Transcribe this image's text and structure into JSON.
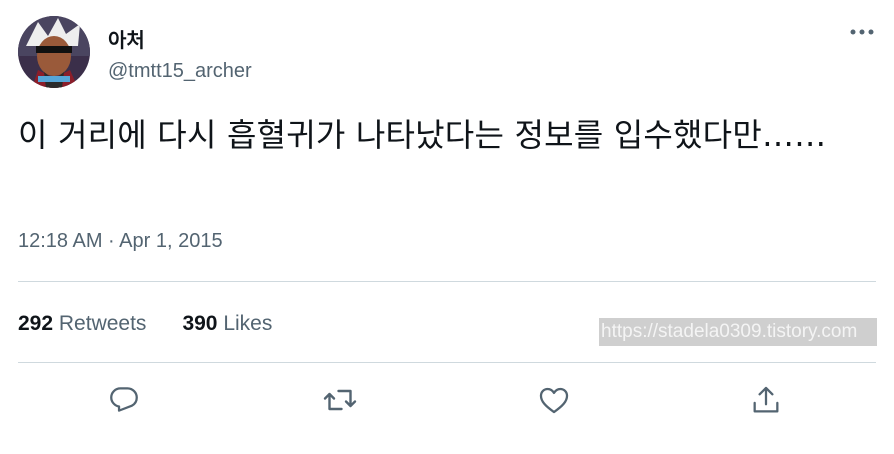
{
  "author": {
    "display_name": "아처",
    "handle": "@tmtt15_archer"
  },
  "tweet": {
    "text": "이 거리에 다시 흡혈귀가 나타났다는 정보를 입수했다만……",
    "timestamp": "12:18 AM · Apr 1, 2015"
  },
  "stats": {
    "retweets_count": "292",
    "retweets_label": "Retweets",
    "likes_count": "390",
    "likes_label": "Likes"
  },
  "watermark": "https://stadela0309.tistory.com",
  "icons": {
    "more": "more-horizontal-icon",
    "reply": "reply-icon",
    "retweet": "retweet-icon",
    "like": "heart-icon",
    "share": "share-icon"
  },
  "colors": {
    "text": "#0f1419",
    "secondary": "#536471",
    "divider": "#cfd9de"
  }
}
